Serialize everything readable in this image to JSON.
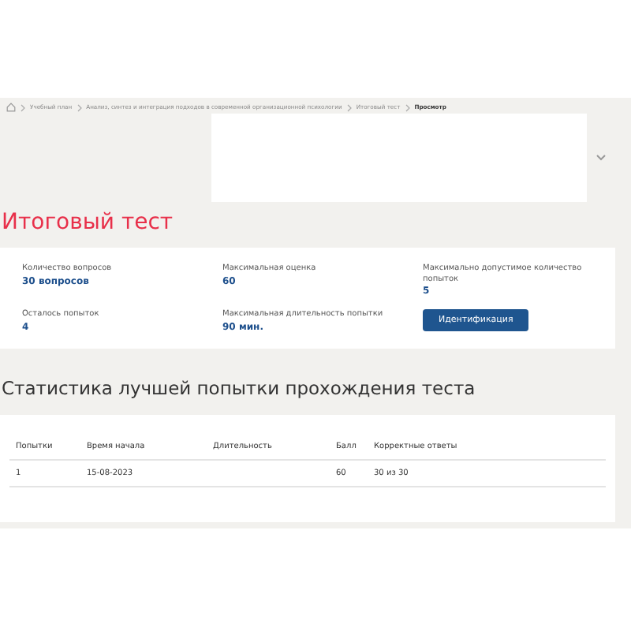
{
  "breadcrumbs": [
    {
      "label": "Учебный план",
      "current": false
    },
    {
      "label": "Анализ, синтез и интеграция подходов в современной организационной психологии",
      "current": false
    },
    {
      "label": "Итоговый тест",
      "current": false
    },
    {
      "label": "Просмотр",
      "current": true
    }
  ],
  "title": "Итоговый тест",
  "stats": [
    {
      "label": "Количество вопросов",
      "value": "30 вопросов"
    },
    {
      "label": "Максимальная оценка",
      "value": "60"
    },
    {
      "label": "Максимально допустимое количество попыток",
      "value": "5"
    },
    {
      "label": "Осталось попыток",
      "value": "4"
    },
    {
      "label": "Максимальная длительность попытки",
      "value": "90 мин."
    }
  ],
  "identify_button": "Идентификация",
  "best_attempt": {
    "heading": "Статистика лучшей попытки прохождения теста",
    "columns": [
      "Попытки",
      "Время начала",
      "Длительность",
      "Балл",
      "Корректные ответы"
    ],
    "rows": [
      [
        "1",
        "15-08-2023",
        "",
        "60",
        "30 из 30"
      ]
    ]
  }
}
